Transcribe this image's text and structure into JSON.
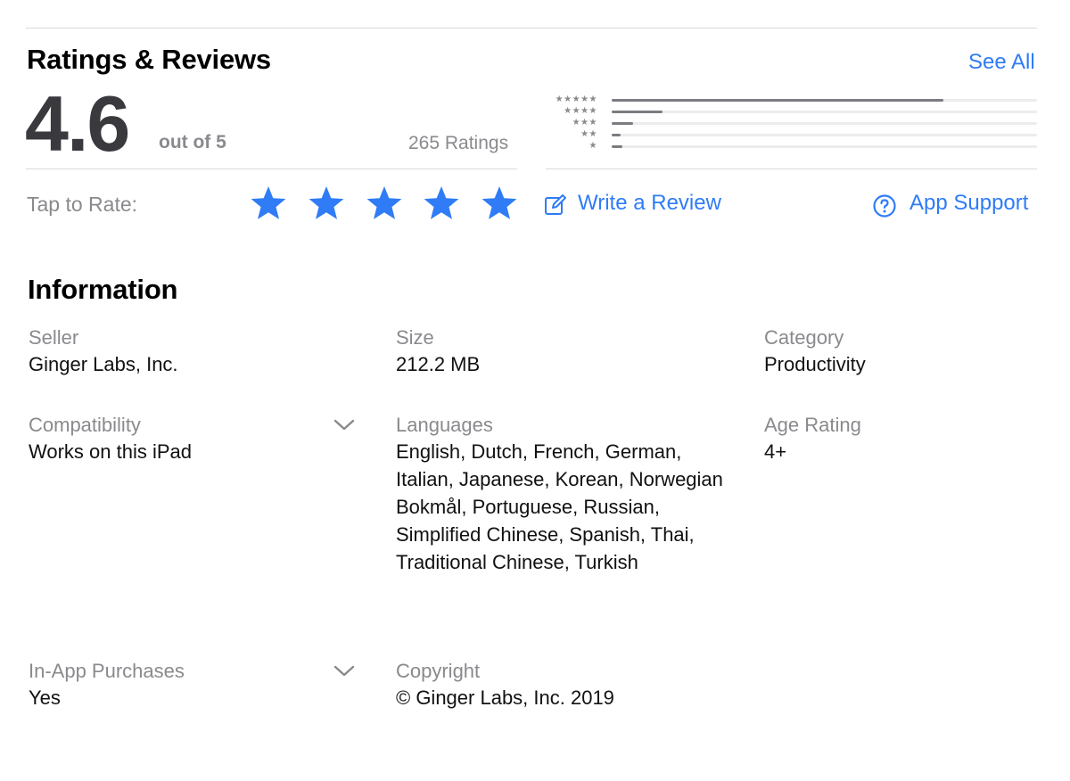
{
  "ratings": {
    "heading": "Ratings & Reviews",
    "see_all": "See All",
    "average": "4.6",
    "out_of": "out of 5",
    "count_text": "265 Ratings",
    "histogram": [
      {
        "stars": "★★★★★",
        "fraction": 0.78
      },
      {
        "stars": "★★★★",
        "fraction": 0.12
      },
      {
        "stars": "★★★",
        "fraction": 0.05
      },
      {
        "stars": "★★",
        "fraction": 0.02
      },
      {
        "stars": "★",
        "fraction": 0.025
      }
    ],
    "tap_to_rate": "Tap to Rate:",
    "rate_star_count": 5,
    "write_review": "Write a Review",
    "app_support": "App Support",
    "accent_color": "#2f7cf6"
  },
  "information": {
    "heading": "Information",
    "seller": {
      "label": "Seller",
      "value": "Ginger Labs, Inc."
    },
    "size": {
      "label": "Size",
      "value": "212.2 MB"
    },
    "category": {
      "label": "Category",
      "value": "Productivity"
    },
    "compatibility": {
      "label": "Compatibility",
      "value": "Works on this iPad"
    },
    "languages": {
      "label": "Languages",
      "value": "English, Dutch, French, German, Italian, Japanese, Korean, Norwegian Bokmål, Portuguese, Russian, Simplified Chinese, Spanish, Thai, Traditional Chinese, Turkish"
    },
    "age_rating": {
      "label": "Age Rating",
      "value": "4+"
    },
    "in_app_purchases": {
      "label": "In-App Purchases",
      "value": "Yes"
    },
    "copyright": {
      "label": "Copyright",
      "value": "© Ginger Labs, Inc. 2019"
    }
  }
}
